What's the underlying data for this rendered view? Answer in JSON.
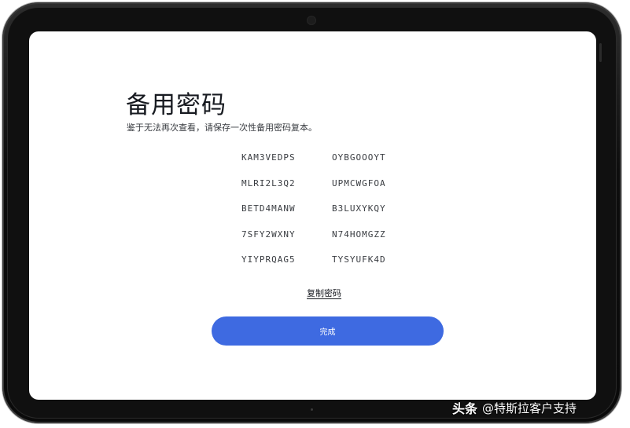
{
  "page": {
    "title": "备用密码",
    "subtitle": "鉴于无法再次查看，请保存一次性备用密码复本。"
  },
  "codes": [
    [
      "KAM3VEDPS",
      "OYBGOOOYT"
    ],
    [
      "MLRI2L3Q2",
      "UPMCWGFOA"
    ],
    [
      "BETD4MANW",
      "B3LUXYKQY"
    ],
    [
      "7SFY2WXNY",
      "N74HOMGZZ"
    ],
    [
      "YIYPRQAG5",
      "TYSYUFK4D"
    ]
  ],
  "actions": {
    "copy_label": "复制密码",
    "done_label": "完成"
  },
  "watermark": {
    "logo_text": "头条",
    "handle": "@特斯拉客户支持"
  },
  "colors": {
    "accent": "#3e6ae1",
    "text_primary": "#171a20",
    "text_secondary": "#393c41",
    "bezel": "#0d0d0d"
  }
}
